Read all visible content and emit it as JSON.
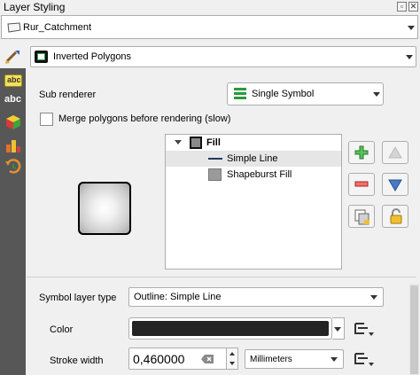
{
  "window": {
    "title": "Layer Styling"
  },
  "layer": {
    "name": "Rur_Catchment"
  },
  "renderer": {
    "selected": "Inverted Polygons"
  },
  "sub_renderer": {
    "label": "Sub renderer",
    "selected": "Single Symbol"
  },
  "merge": {
    "label": "Merge polygons before rendering (slow)",
    "checked": false
  },
  "symbol_tree": {
    "items": [
      {
        "label": "Fill",
        "level": 0,
        "bold": true
      },
      {
        "label": "Simple Line",
        "level": 1,
        "selected": true
      },
      {
        "label": "Shapeburst Fill",
        "level": 1
      }
    ]
  },
  "symbol_layer_type": {
    "label": "Symbol layer type",
    "selected": "Outline: Simple Line"
  },
  "color": {
    "label": "Color",
    "value": "#232323"
  },
  "stroke_width": {
    "label": "Stroke width",
    "value": "0,460000",
    "unit": "Millimeters"
  },
  "colors": {
    "add": "#3aa53a",
    "remove": "#e03030",
    "up_disabled": "#cfcfcf",
    "down": "#3f6fb6",
    "lock": "#e8b828"
  },
  "tabs": [
    {
      "icon": "paintbrush-icon"
    },
    {
      "icon": "label-abc-icon"
    },
    {
      "icon": "label-abc-blue-icon"
    },
    {
      "icon": "3d-cube-icon"
    },
    {
      "icon": "diagram-icon"
    },
    {
      "icon": "history-icon"
    }
  ]
}
